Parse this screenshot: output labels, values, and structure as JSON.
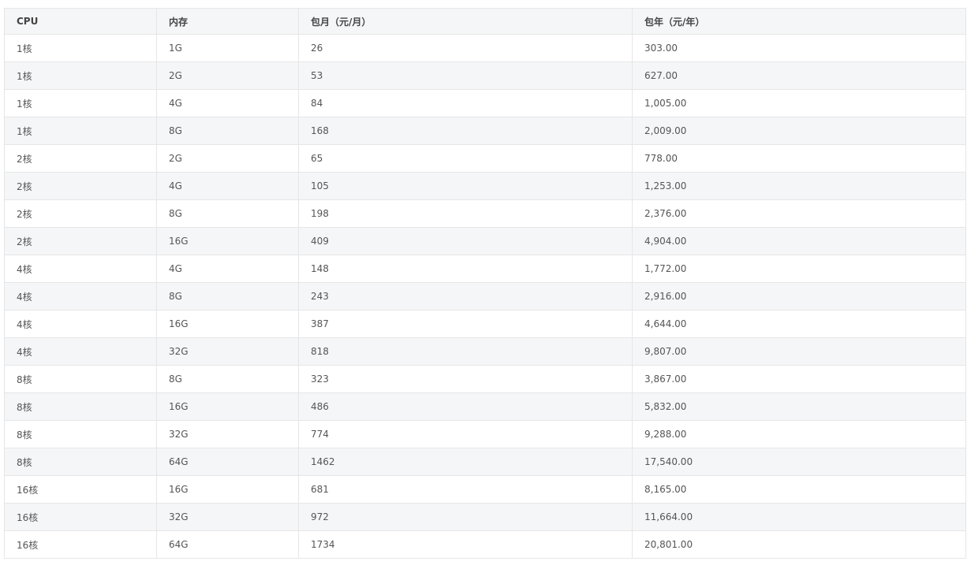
{
  "table": {
    "headers": [
      "CPU",
      "内存",
      "包月（元/月）",
      "包年（元/年）"
    ],
    "rows": [
      [
        "1核",
        "1G",
        "26",
        "303.00"
      ],
      [
        "1核",
        "2G",
        "53",
        "627.00"
      ],
      [
        "1核",
        "4G",
        "84",
        "1,005.00"
      ],
      [
        "1核",
        "8G",
        "168",
        "2,009.00"
      ],
      [
        "2核",
        "2G",
        "65",
        "778.00"
      ],
      [
        "2核",
        "4G",
        "105",
        "1,253.00"
      ],
      [
        "2核",
        "8G",
        "198",
        "2,376.00"
      ],
      [
        "2核",
        "16G",
        "409",
        "4,904.00"
      ],
      [
        "4核",
        "4G",
        "148",
        "1,772.00"
      ],
      [
        "4核",
        "8G",
        "243",
        "2,916.00"
      ],
      [
        "4核",
        "16G",
        "387",
        "4,644.00"
      ],
      [
        "4核",
        "32G",
        "818",
        "9,807.00"
      ],
      [
        "8核",
        "8G",
        "323",
        "3,867.00"
      ],
      [
        "8核",
        "16G",
        "486",
        "5,832.00"
      ],
      [
        "8核",
        "32G",
        "774",
        "9,288.00"
      ],
      [
        "8核",
        "64G",
        "1462",
        "17,540.00"
      ],
      [
        "16核",
        "16G",
        "681",
        "8,165.00"
      ],
      [
        "16核",
        "32G",
        "972",
        "11,664.00"
      ],
      [
        "16核",
        "64G",
        "1734",
        "20,801.00"
      ]
    ]
  }
}
